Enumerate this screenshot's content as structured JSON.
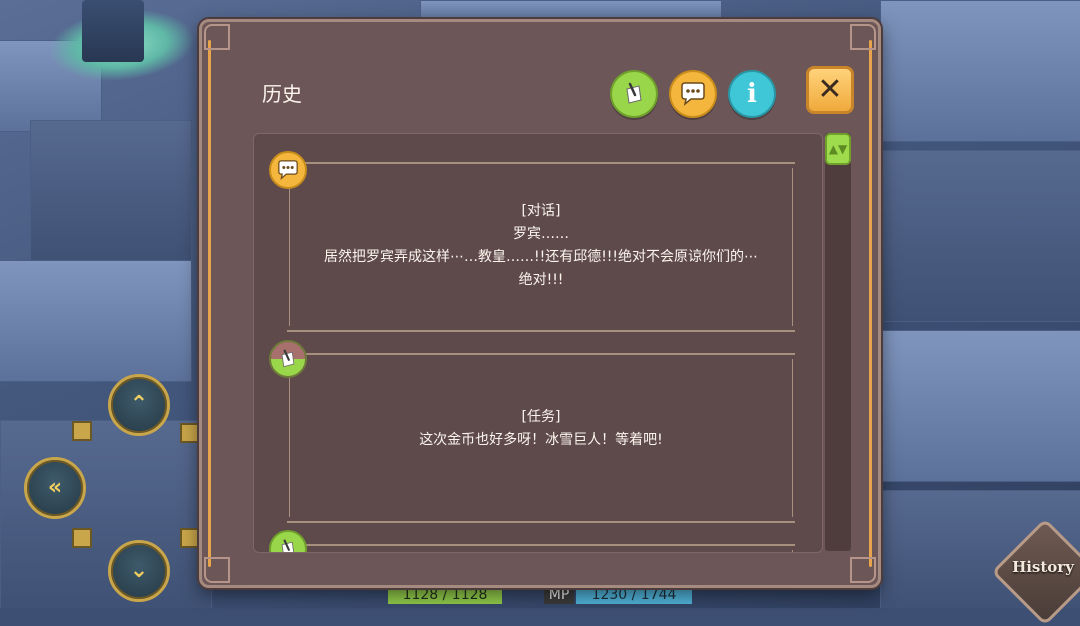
{
  "dialog": {
    "title": "历史",
    "filters": {
      "task_icon": "quest-scroll-icon",
      "talk_icon": "speech-bubble-icon",
      "info_icon": "info-icon",
      "info_glyph": "i"
    },
    "close_icon": "close-icon",
    "close_glyph": "✕"
  },
  "log_entries": [
    {
      "type_icon": "speech-bubble-icon",
      "category": "[对话]",
      "lines": [
        "罗宾……",
        "居然把罗宾弄成这样⋯…教皇……!!还有邱德!!!绝对不会原谅你们的⋯",
        "绝对!!!"
      ]
    },
    {
      "type_icon": "quest-scroll-icon",
      "category": "[任务]",
      "lines": [
        "这次金币也好多呀！冰雪巨人！等着吧!"
      ]
    },
    {
      "type_icon": "quest-scroll-icon",
      "category": "",
      "lines": []
    }
  ],
  "scrollbar": {
    "thumb_glyph": "▲▼"
  },
  "hud": {
    "hp_text": "1128 / 1128",
    "mp_label": "MP",
    "mp_text": "1230 / 1744",
    "history_label": "History"
  },
  "colors": {
    "panel": "#6c5657",
    "accent_orange": "#e8a44a",
    "task_green": "#9ad64a",
    "talk_yellow": "#f5b63d",
    "info_cyan": "#3fc7d8"
  }
}
